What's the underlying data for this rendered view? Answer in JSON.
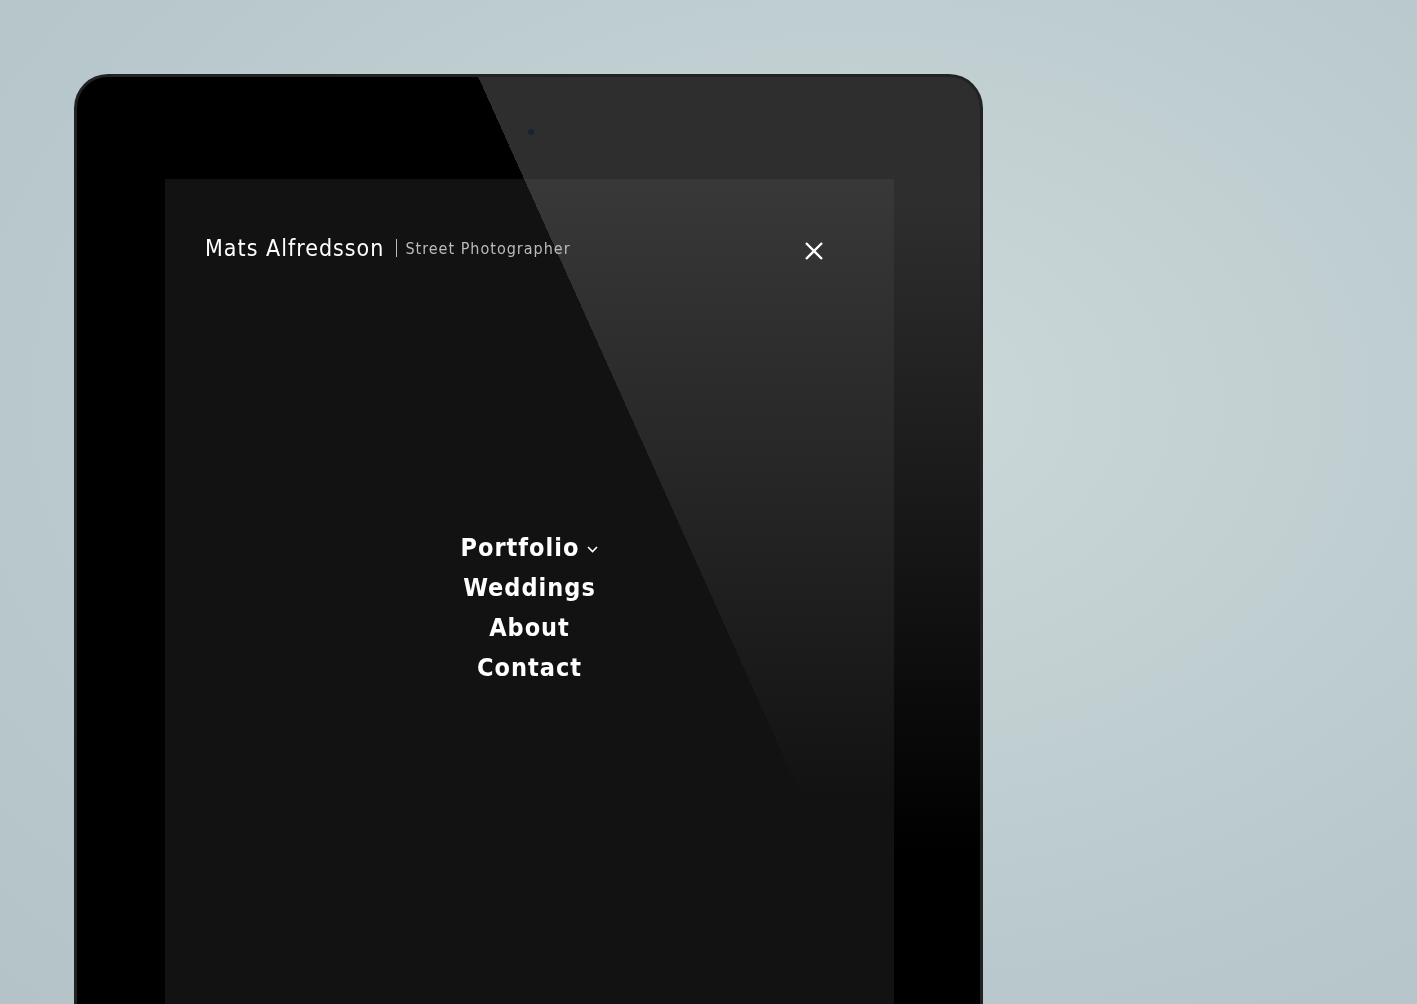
{
  "site": {
    "title": "Mats Alfredsson",
    "subtitle": "Street Photographer"
  },
  "menu": [
    {
      "label": "Portfolio",
      "has_submenu": true
    },
    {
      "label": "Weddings",
      "has_submenu": false
    },
    {
      "label": "About",
      "has_submenu": false
    },
    {
      "label": "Contact",
      "has_submenu": false
    }
  ]
}
